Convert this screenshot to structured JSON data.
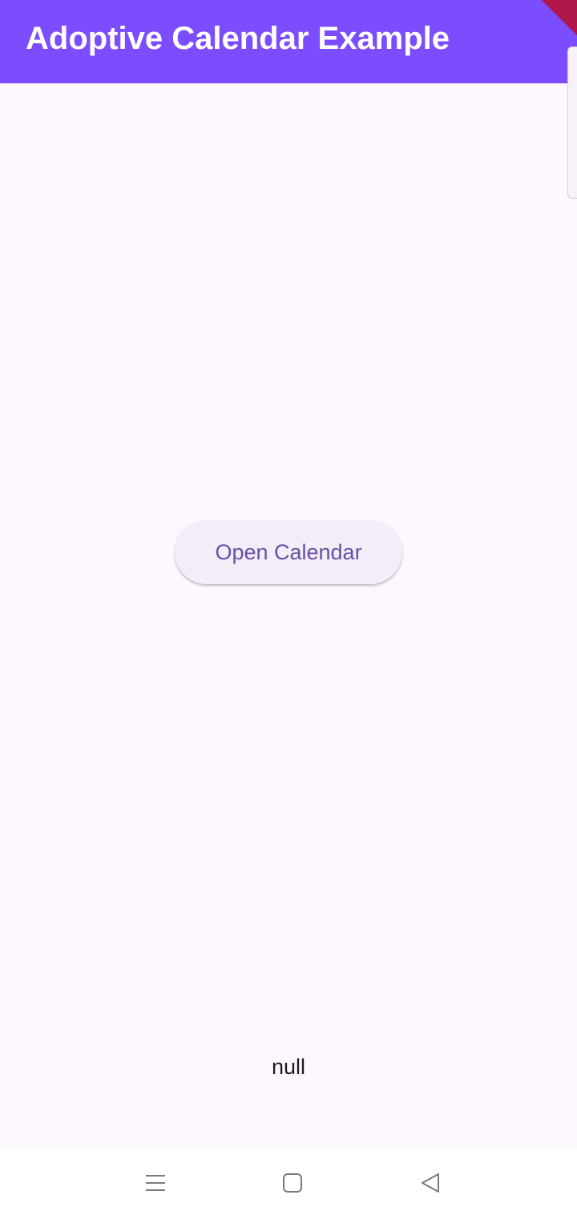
{
  "app_bar": {
    "title": "Adoptive Calendar Example",
    "background": "#7c4dff"
  },
  "main": {
    "open_calendar_label": "Open Calendar",
    "result_text": "null"
  },
  "nav_bar": {
    "icons": [
      "menu-icon",
      "home-icon",
      "back-icon"
    ]
  },
  "colors": {
    "accent": "#7c4dff",
    "button_text": "#6750a4",
    "button_bg": "#f4edf8",
    "page_bg": "#fef7ff"
  }
}
